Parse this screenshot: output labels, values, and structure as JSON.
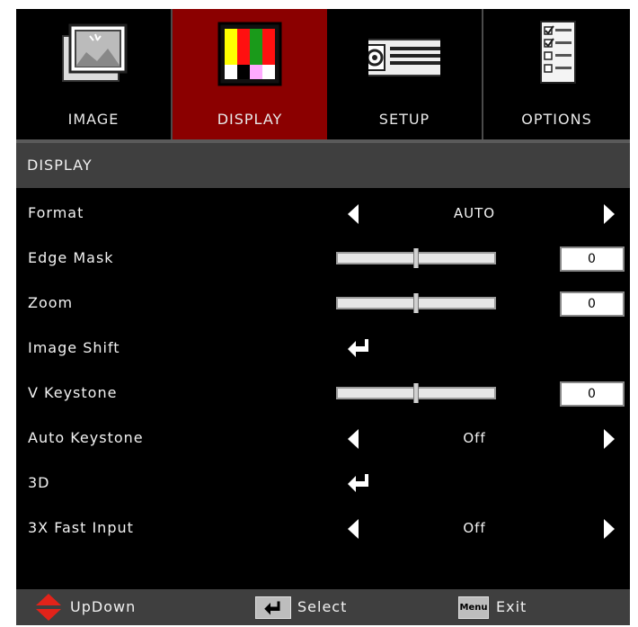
{
  "tabs": [
    {
      "label": "IMAGE",
      "icon": "image-icon",
      "active": false
    },
    {
      "label": "DISPLAY",
      "icon": "display-color-bars-icon",
      "active": true
    },
    {
      "label": "SETUP",
      "icon": "projector-setup-icon",
      "active": false
    },
    {
      "label": "OPTIONS",
      "icon": "options-checklist-icon",
      "active": false
    }
  ],
  "section_title": "DISPLAY",
  "menu": {
    "format": {
      "label": "Format",
      "value": "AUTO"
    },
    "edge_mask": {
      "label": "Edge Mask",
      "value": "0",
      "level": 0.5
    },
    "zoom": {
      "label": "Zoom",
      "value": "0",
      "level": 0.5
    },
    "image_shift": {
      "label": "Image Shift"
    },
    "v_keystone": {
      "label": "V Keystone",
      "value": "0",
      "level": 0.5
    },
    "auto_keystone": {
      "label": "Auto Keystone",
      "value": "Off"
    },
    "three_d": {
      "label": "3D"
    },
    "fast_input": {
      "label": "3X Fast Input",
      "value": "Off"
    }
  },
  "footer": {
    "updown": "UpDown",
    "select": "Select",
    "menu_key": "Menu",
    "exit": "Exit"
  },
  "colors": {
    "active_tab": "#8b0000",
    "header_bar": "#3f3f3f",
    "updown_arrow": "#e2231a"
  }
}
